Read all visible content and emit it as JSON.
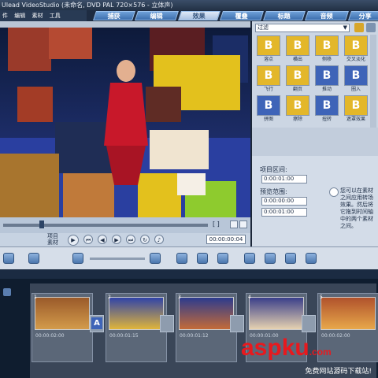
{
  "window": {
    "title": "Ulead VideoStudio (未命名, DVD PAL 720×576 - 立体声)"
  },
  "menu": [
    "件",
    "编辑",
    "素材",
    "工具"
  ],
  "steps": [
    {
      "label": "捕获",
      "active": false
    },
    {
      "label": "编辑",
      "active": false
    },
    {
      "label": "效果",
      "active": true
    },
    {
      "label": "覆叠",
      "active": false
    },
    {
      "label": "标题",
      "active": false
    },
    {
      "label": "音频",
      "active": false
    },
    {
      "label": "分享",
      "active": false
    }
  ],
  "preview": {
    "trim_label": "[ ]",
    "mode_labels": [
      "项目",
      "素材"
    ],
    "timecode": "00:00:00:04"
  },
  "library": {
    "category": "过滤",
    "thumbs": [
      {
        "label": "溶点",
        "letter": "B"
      },
      {
        "label": "横出",
        "letter": "B"
      },
      {
        "label": "侧移",
        "letter": "B"
      },
      {
        "label": "交叉淡化",
        "letter": "B"
      },
      {
        "label": "飞行",
        "letter": "B"
      },
      {
        "label": "翻页",
        "letter": "B"
      },
      {
        "label": "推动",
        "letter": "B"
      },
      {
        "label": "圈入",
        "letter": "B"
      },
      {
        "label": "拼图",
        "letter": "B"
      },
      {
        "label": "擦除",
        "letter": "B"
      },
      {
        "label": "扭转",
        "letter": "B"
      },
      {
        "label": "遮罩效果",
        "letter": "B"
      }
    ]
  },
  "options": {
    "duration_label": "项目区间:",
    "duration_value": "0:00:01:00",
    "preview_range_label": "预览范围:",
    "range_start": "0:00:00:00",
    "range_end": "0:00:01:00",
    "hint": "您可以在素材之间应用转场效果。然后将它拖到时间轴中的两个素材之间。"
  },
  "timeline": {
    "clips": [
      {
        "num": "1",
        "time": "00:00:02:00"
      },
      {
        "num": "2",
        "time": "00:00:01:15"
      },
      {
        "num": "3",
        "time": "00:00:01:12"
      },
      {
        "num": "4",
        "time": "00:00:01:00"
      },
      {
        "num": "5",
        "time": "00:00:02:00"
      }
    ]
  },
  "watermark": {
    "brand": "aspku",
    "suffix": ".com",
    "tagline": "免费网站源码下载站!"
  }
}
